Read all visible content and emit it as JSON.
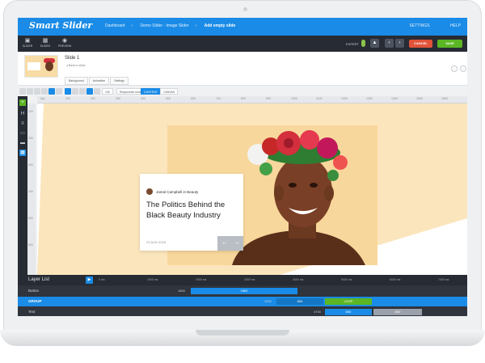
{
  "app": {
    "logo": "Smart Slider",
    "breadcrumbs": [
      "Dashboard",
      "Demo Slider - Image Slider",
      "Add empty slide"
    ],
    "topnav": [
      "SETTINGS",
      "HELP"
    ]
  },
  "toolbar": {
    "tools": [
      {
        "label": "SLIDER",
        "icon": "▣"
      },
      {
        "label": "SLIDES",
        "icon": "▦"
      },
      {
        "label": "PREVIEW",
        "icon": "◉"
      }
    ],
    "expert_label": "EXPERT",
    "cancel_label": "CANCEL",
    "save_label": "SAVE"
  },
  "slide": {
    "name": "Slide 1",
    "back_link": "◂ Back to slider",
    "tabs": [
      "Background",
      "Animation",
      "Settings"
    ]
  },
  "edit_tools": {
    "zoom": "100",
    "responsive": "Responsive mode",
    "options": [
      "CONTENT",
      "CANVAS"
    ]
  },
  "ruler": {
    "ticks": [
      "0px",
      "100",
      "200",
      "300",
      "400",
      "500",
      "600",
      "700",
      "800",
      "900",
      "1000",
      "1100",
      "1200",
      "1300",
      "1400",
      "1500",
      "1600"
    ],
    "vticks": [
      "100",
      "200",
      "300",
      "400",
      "500",
      "600"
    ]
  },
  "card": {
    "author": "Jamal Campbell in Beauty",
    "headline": "The Politics Behind the Black Beauty Industry",
    "date": "23 AUG 2018",
    "prev_arrow": "←",
    "next_arrow": "→"
  },
  "timeline": {
    "title": "Layer List",
    "ticks": [
      "0 ms",
      "1000 ms",
      "2000 ms",
      "3000 ms",
      "4000 ms",
      "5000 ms",
      "6000 ms",
      "7000 ms"
    ],
    "rows": [
      {
        "name": "Button",
        "start": "1800",
        "bar": "1800",
        "selected": false
      },
      {
        "name": "GROUP",
        "start": "3500",
        "bar": "800",
        "extra": "LOOP",
        "selected": true
      },
      {
        "name": "Text",
        "start": "4700",
        "bar": "800",
        "extra": "800",
        "selected": false
      }
    ]
  },
  "colors": {
    "accent": "#1a8be6",
    "cancel": "#e0533a",
    "save": "#5bb624",
    "dark": "#272b33",
    "canvas_bg": "#fbe5bc"
  }
}
